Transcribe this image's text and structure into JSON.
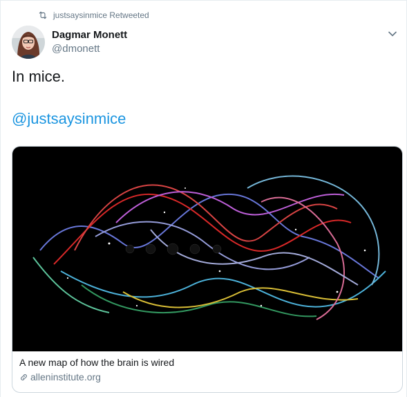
{
  "retweet_context": {
    "icon": "retweet-icon",
    "label": "justsaysinmice Retweeted"
  },
  "author": {
    "name": "Dagmar Monett",
    "handle": "@dmonett",
    "avatar": "avatar-photo"
  },
  "menu": {
    "icon": "chevron-down-icon"
  },
  "tweet": {
    "text": "In mice.",
    "mention": "@justsaysinmice"
  },
  "card": {
    "image": "brain-wiring-illustration",
    "title": "A new map of how the brain is wired",
    "domain": "alleninstitute.org",
    "link_icon": "link-icon"
  },
  "colors": {
    "text_primary": "#14171a",
    "text_secondary": "#657786",
    "link": "#1b95e0",
    "border": "#ccd6dd",
    "card_image_bg": "#000000"
  }
}
